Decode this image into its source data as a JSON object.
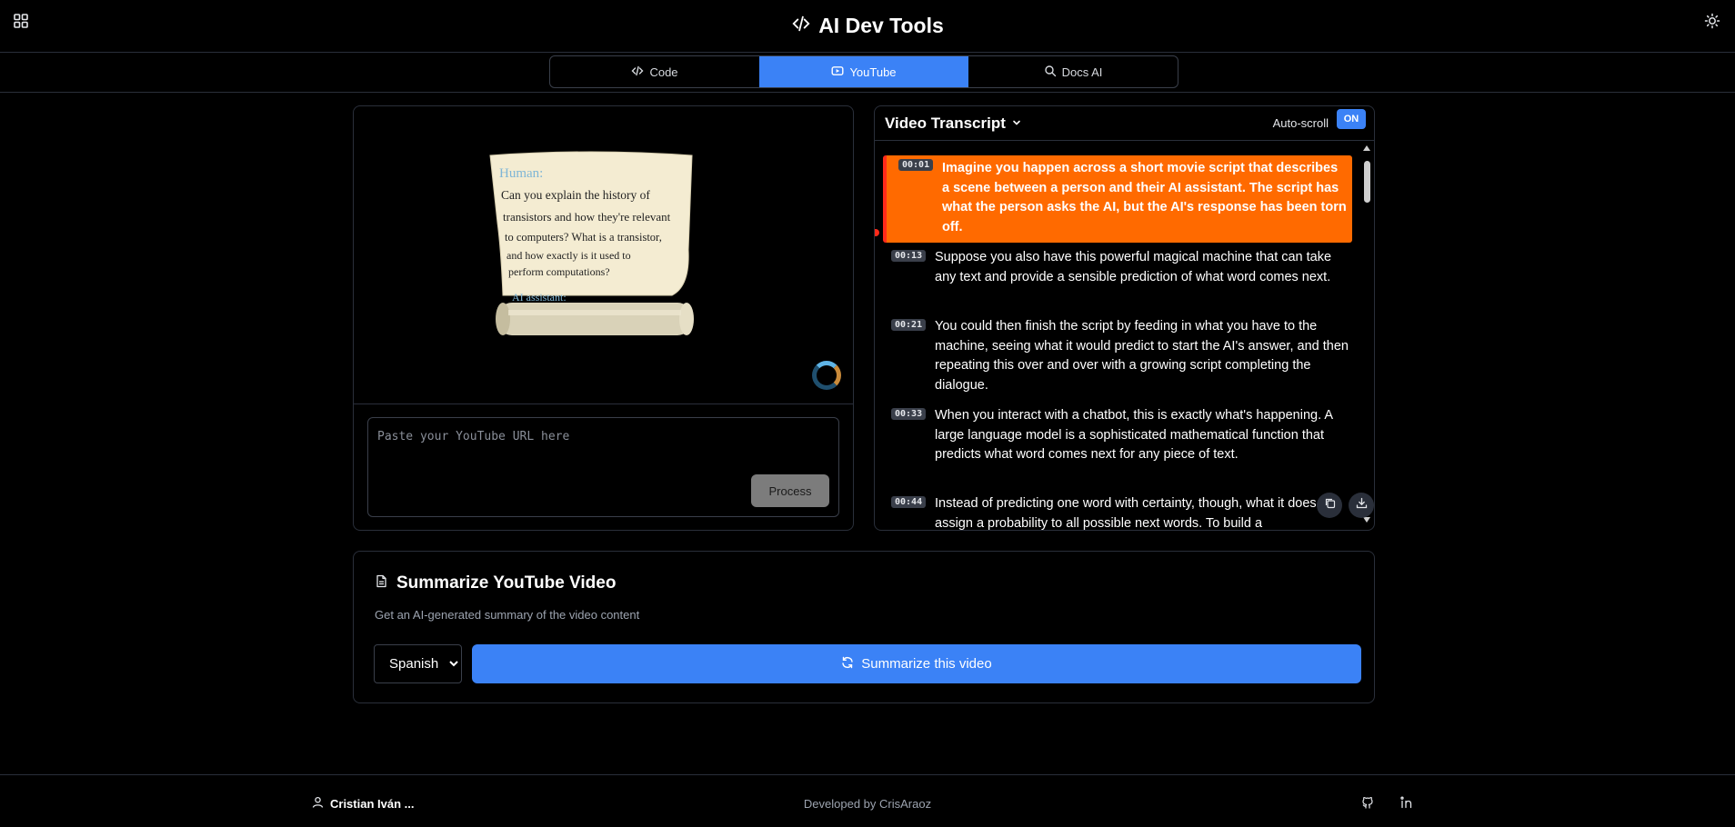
{
  "app": {
    "title": "AI Dev Tools",
    "menu_icon": "grid-icon",
    "theme_icon": "sun-icon"
  },
  "tabs": [
    {
      "label": "Code",
      "icon": "code-icon",
      "active": false
    },
    {
      "label": "YouTube",
      "icon": "youtube-icon",
      "active": true
    },
    {
      "label": "Docs AI",
      "icon": "search-icon",
      "active": false
    }
  ],
  "video": {
    "scroll_human_label": "Human:",
    "scroll_text": "Can you explain the history of transistors and how they're relevant to computers? What is a transistor, and how exactly is it used to perform computations?",
    "scroll_ai_label": "AI assistant:",
    "url_placeholder": "Paste your YouTube URL here",
    "url_value": "",
    "process_label": "Process"
  },
  "transcript": {
    "title": "Video Transcript",
    "autoscroll_label": "Auto-scroll",
    "autoscroll_state": "ON",
    "entries": [
      {
        "time": "00:01",
        "text": "Imagine you happen across a short movie script that describes a scene between a person and their AI assistant. The script has what the person asks the AI, but the AI's response has been torn off.",
        "active": true
      },
      {
        "time": "00:13",
        "text": "Suppose you also have this powerful magical machine that can take any text and provide a sensible prediction of what word comes next.",
        "active": false
      },
      {
        "time": "00:21",
        "text": "You could then finish the script by feeding in what you have to the machine, seeing what it would predict to start the AI's answer, and then repeating this over and over with a growing script completing the dialogue.",
        "active": false
      },
      {
        "time": "00:33",
        "text": "When you interact with a chatbot, this is exactly what's happening. A large language model is a sophisticated mathematical function that predicts what word comes next for any piece of text.",
        "active": false
      },
      {
        "time": "00:44",
        "text": "Instead of predicting one word with certainty, though, what it does is assign a probability to all possible next words. To build a",
        "active": false
      }
    ]
  },
  "summary": {
    "title": "Summarize YouTube Video",
    "description": "Get an AI-generated summary of the video content",
    "language": "Spanish",
    "button_label": "Summarize this video"
  },
  "footer": {
    "user": "Cristian Iván ...",
    "developed_by": "Developed by CrisAraoz"
  },
  "colors": {
    "accent": "#3b82f6",
    "highlight": "#ff6a00",
    "border": "#2a2f3a"
  }
}
